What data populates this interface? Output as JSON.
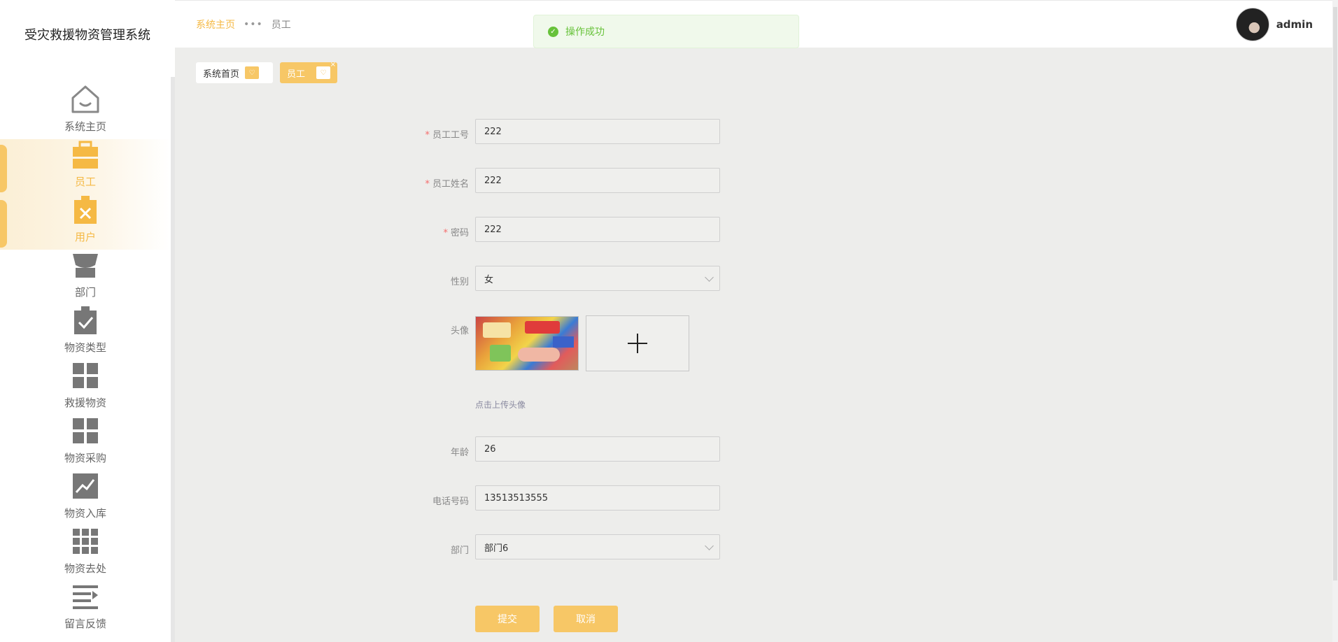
{
  "app": {
    "title": "受灾救援物资管理系统"
  },
  "sidebar": {
    "items": [
      {
        "label": "系统主页",
        "icon": "home-icon"
      },
      {
        "label": "员工",
        "icon": "briefcase-icon"
      },
      {
        "label": "用户",
        "icon": "clipboard-x-icon"
      },
      {
        "label": "部门",
        "icon": "store-icon"
      },
      {
        "label": "物资类型",
        "icon": "clipboard-check-icon"
      },
      {
        "label": "救援物资",
        "icon": "grid-icon"
      },
      {
        "label": "物资采购",
        "icon": "grid-icon"
      },
      {
        "label": "物资入库",
        "icon": "chart-line-icon"
      },
      {
        "label": "物资去处",
        "icon": "grid-nine-icon"
      },
      {
        "label": "留言反馈",
        "icon": "list-arrow-icon"
      }
    ],
    "active_index": 1,
    "hover_index": 2
  },
  "header": {
    "breadcrumb_home": "系统主页",
    "breadcrumb_sep": "•••",
    "breadcrumb_current": "员工",
    "toast": "操作成功",
    "username": "admin"
  },
  "tabs": [
    {
      "label": "系统首页"
    },
    {
      "label": "员工",
      "close": "×"
    }
  ],
  "form": {
    "emp_no": {
      "label": "员工工号",
      "value": "222",
      "required": true
    },
    "emp_name": {
      "label": "员工姓名",
      "value": "222",
      "required": true
    },
    "password": {
      "label": "密码",
      "value": "222",
      "required": true
    },
    "gender": {
      "label": "性别",
      "value": "女"
    },
    "avatar": {
      "label": "头像",
      "hint": "点击上传头像"
    },
    "age": {
      "label": "年龄",
      "value": "26"
    },
    "phone": {
      "label": "电话号码",
      "value": "13513513555"
    },
    "department": {
      "label": "部门",
      "value": "部门6"
    },
    "submit_label": "提交",
    "cancel_label": "取消"
  },
  "colors": {
    "accent": "#f7c766",
    "accent_text": "#f5b944",
    "success": "#67c23a"
  }
}
